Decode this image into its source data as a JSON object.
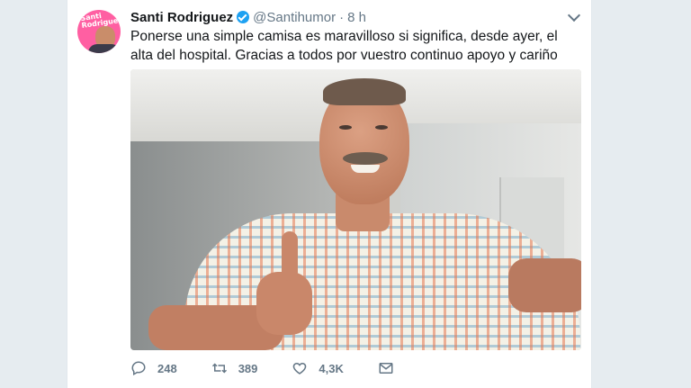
{
  "tweet": {
    "display_name": "Santi Rodriguez",
    "handle": "@Santihumor",
    "separator": "·",
    "time": "8 h",
    "text": "Ponerse una simple camisa es maravilloso si significa, desde ayer, el alta del hospital. Gracias a todos por vuestro continuo apoyo y cariño",
    "avatar_label": "Santi Rodriguez"
  },
  "actions": {
    "reply_count": "248",
    "retweet_count": "389",
    "like_count": "4,3K",
    "icons": [
      "reply-icon",
      "retweet-icon",
      "like-icon",
      "message-icon"
    ]
  },
  "colors": {
    "background": "#e6ecf0",
    "card": "#ffffff",
    "verified": "#1da1f2",
    "avatar_bg": "#ff5fa2",
    "muted_text": "#657786"
  }
}
